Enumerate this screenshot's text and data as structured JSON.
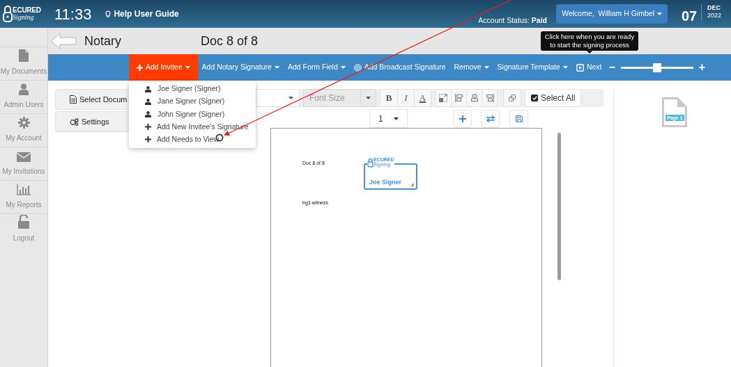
{
  "header": {
    "logo": {
      "word": "ECURED",
      "script": "Signing"
    },
    "clock": "11:33",
    "help_link": "Help User Guide",
    "account_status_label": "Account Status:",
    "account_status": "Paid",
    "welcome_button": "Welcome,  William H Gimbel",
    "day": "07",
    "month": "DEC",
    "year": "2022"
  },
  "sidebar": {
    "items": [
      {
        "kind": "document",
        "label": "My Documents"
      },
      {
        "kind": "user",
        "label": "Admin Users"
      },
      {
        "kind": "gear",
        "label": "My Account"
      },
      {
        "kind": "envelope",
        "label": "My Invitations"
      },
      {
        "kind": "chart",
        "label": "My Reports"
      },
      {
        "kind": "lock",
        "label": "Logout"
      }
    ]
  },
  "title_bar": {
    "title": "Notary",
    "doc_counter": "Doc 8 of 8"
  },
  "toolbar": {
    "items": [
      {
        "kind": "add",
        "label": "Add Invitee",
        "selected": true
      },
      {
        "kind": "menu",
        "label": "Add Notary Signature",
        "selected": false
      },
      {
        "kind": "menu",
        "label": "Add Form Field",
        "selected": false
      },
      {
        "kind": "broadcast",
        "label": "Add Broadcast Signature",
        "selected": false
      },
      {
        "kind": "menu",
        "label": "Remove",
        "selected": false
      },
      {
        "kind": "menu",
        "label": "Signature Template",
        "selected": false
      },
      {
        "kind": "next",
        "label": "Next",
        "selected": false
      }
    ],
    "zoom": {
      "minus": "−",
      "plus": "+",
      "level": 0.5
    }
  },
  "tooltip": "Click here when you are ready to start the signing process",
  "invitee_menu": {
    "items": [
      {
        "kind": "signer",
        "label": "Joe Signer (Signer)"
      },
      {
        "kind": "signer",
        "label": "Jane Signer (Signer)"
      },
      {
        "kind": "signer",
        "label": "John Signer (Signer)"
      },
      {
        "kind": "add",
        "label": "Add New Invitee's Signature"
      },
      {
        "kind": "add",
        "label": "Add Needs to View"
      }
    ]
  },
  "left_panel": {
    "buttons": [
      {
        "kind": "document",
        "label": "Select Docum"
      },
      {
        "kind": "settings",
        "label": "Settings"
      }
    ]
  },
  "format_toolbar": {
    "font_size_placeholder": "Font Size",
    "style_buttons": [
      "B",
      "I",
      "A"
    ],
    "select_all": {
      "label": "Select All",
      "checked": true
    }
  },
  "page_select": {
    "value": "1"
  },
  "document": {
    "texts": [
      {
        "label": "Doc 8 of 8"
      },
      {
        "label": "bg3 witness"
      }
    ],
    "signature": {
      "logo_word": "ECURED",
      "logo_script": "Signing",
      "signer": "Joe Signer"
    }
  },
  "thumbnail": {
    "label": "Page 1"
  }
}
